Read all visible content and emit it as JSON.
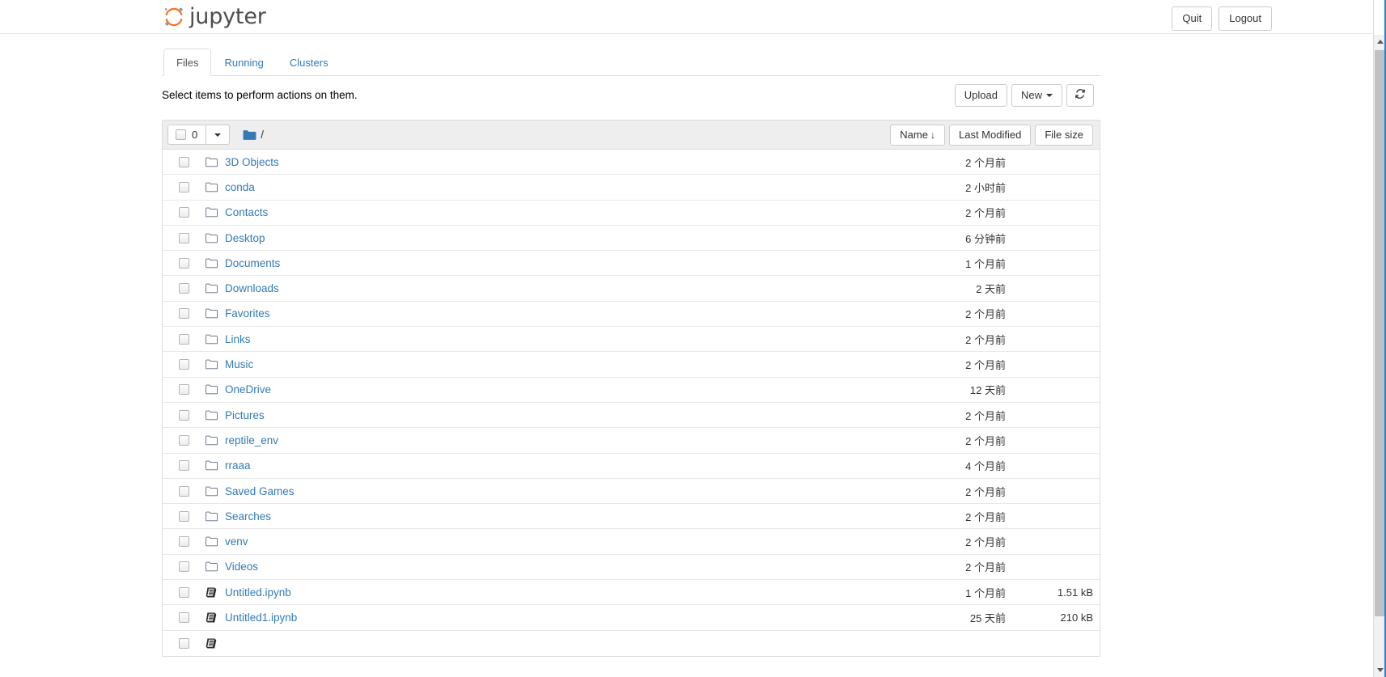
{
  "header": {
    "logo_text": "jupyter",
    "logo_icon": "jupyter-logo-icon",
    "quit_label": "Quit",
    "logout_label": "Logout"
  },
  "tabs": [
    {
      "label": "Files",
      "active": true
    },
    {
      "label": "Running",
      "active": false
    },
    {
      "label": "Clusters",
      "active": false
    }
  ],
  "actions": {
    "select_hint": "Select items to perform actions on them.",
    "upload_label": "Upload",
    "new_label": "New",
    "refresh_icon": "refresh-icon"
  },
  "list_toolbar": {
    "selected_count": "0",
    "select_all_checkbox": "unchecked",
    "dropdown_icon": "chevron-down-icon",
    "breadcrumb_icon": "folder-icon",
    "breadcrumb_path": "/",
    "sort_name_label": "Name",
    "sort_name_arrow": "↓",
    "sort_modified_label": "Last Modified",
    "sort_size_label": "File size"
  },
  "files": [
    {
      "icon": "folder-icon",
      "name": "3D Objects",
      "modified": "2 个月前",
      "size": ""
    },
    {
      "icon": "folder-icon",
      "name": "conda",
      "modified": "2 小时前",
      "size": ""
    },
    {
      "icon": "folder-icon",
      "name": "Contacts",
      "modified": "2 个月前",
      "size": ""
    },
    {
      "icon": "folder-icon",
      "name": "Desktop",
      "modified": "6 分钟前",
      "size": ""
    },
    {
      "icon": "folder-icon",
      "name": "Documents",
      "modified": "1 个月前",
      "size": ""
    },
    {
      "icon": "folder-icon",
      "name": "Downloads",
      "modified": "2 天前",
      "size": ""
    },
    {
      "icon": "folder-icon",
      "name": "Favorites",
      "modified": "2 个月前",
      "size": ""
    },
    {
      "icon": "folder-icon",
      "name": "Links",
      "modified": "2 个月前",
      "size": ""
    },
    {
      "icon": "folder-icon",
      "name": "Music",
      "modified": "2 个月前",
      "size": ""
    },
    {
      "icon": "folder-icon",
      "name": "OneDrive",
      "modified": "12 天前",
      "size": ""
    },
    {
      "icon": "folder-icon",
      "name": "Pictures",
      "modified": "2 个月前",
      "size": ""
    },
    {
      "icon": "folder-icon",
      "name": "reptile_env",
      "modified": "2 个月前",
      "size": ""
    },
    {
      "icon": "folder-icon",
      "name": "rraaa",
      "modified": "4 个月前",
      "size": ""
    },
    {
      "icon": "folder-icon",
      "name": "Saved Games",
      "modified": "2 个月前",
      "size": ""
    },
    {
      "icon": "folder-icon",
      "name": "Searches",
      "modified": "2 个月前",
      "size": ""
    },
    {
      "icon": "folder-icon",
      "name": "venv",
      "modified": "2 个月前",
      "size": ""
    },
    {
      "icon": "folder-icon",
      "name": "Videos",
      "modified": "2 个月前",
      "size": ""
    },
    {
      "icon": "notebook-icon",
      "name": "Untitled.ipynb",
      "modified": "1 个月前",
      "size": "1.51 kB"
    },
    {
      "icon": "notebook-icon",
      "name": "Untitled1.ipynb",
      "modified": "25 天前",
      "size": "210 kB"
    },
    {
      "icon": "notebook-icon",
      "name": "",
      "modified": "",
      "size": ""
    }
  ],
  "colors": {
    "link_blue": "#337ab7",
    "logo_orange": "#f37726",
    "logo_gray": "#4e4e4e",
    "toolbar_bg": "#eeeeee",
    "border": "#dddddd",
    "scrollbar_thumb": "#c1c1c1",
    "focus_ring": "#2f7fd1"
  }
}
